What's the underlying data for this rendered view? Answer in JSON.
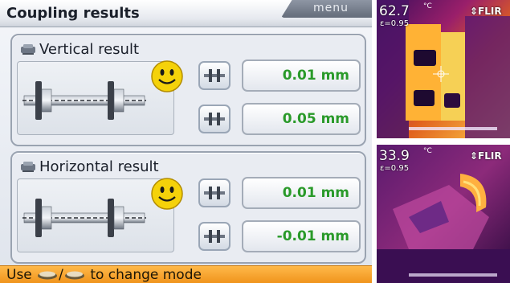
{
  "device": {
    "title": "Coupling results",
    "menu_label": "menu",
    "vertical": {
      "title": "Vertical result",
      "values": [
        "0.01 mm",
        "0.05 mm"
      ]
    },
    "horizontal": {
      "title": "Horizontal result",
      "values": [
        "0.01 mm",
        "-0.01 mm"
      ]
    },
    "status": {
      "prefix": "Use",
      "separator": "/",
      "suffix": "to change mode"
    },
    "colors": {
      "value_text": "#2a9a2a",
      "status_bar": "#f7a530",
      "smiley": "#f5d20a"
    },
    "icons": {
      "panel_icon": "alignment-sensor-icon",
      "mode_button": "coupling-mode-icon",
      "status_keys": [
        "up-key-icon",
        "down-key-icon"
      ],
      "smiley": "smiley-face-icon"
    }
  },
  "thermal": {
    "top": {
      "temperature": "62.7",
      "unit": "°C",
      "emissivity": "ε=0.95",
      "brand": "⇕FLIR"
    },
    "bottom": {
      "temperature": "33.9",
      "unit": "°C",
      "emissivity": "ε=0.95",
      "brand": "⇕FLIR"
    }
  }
}
